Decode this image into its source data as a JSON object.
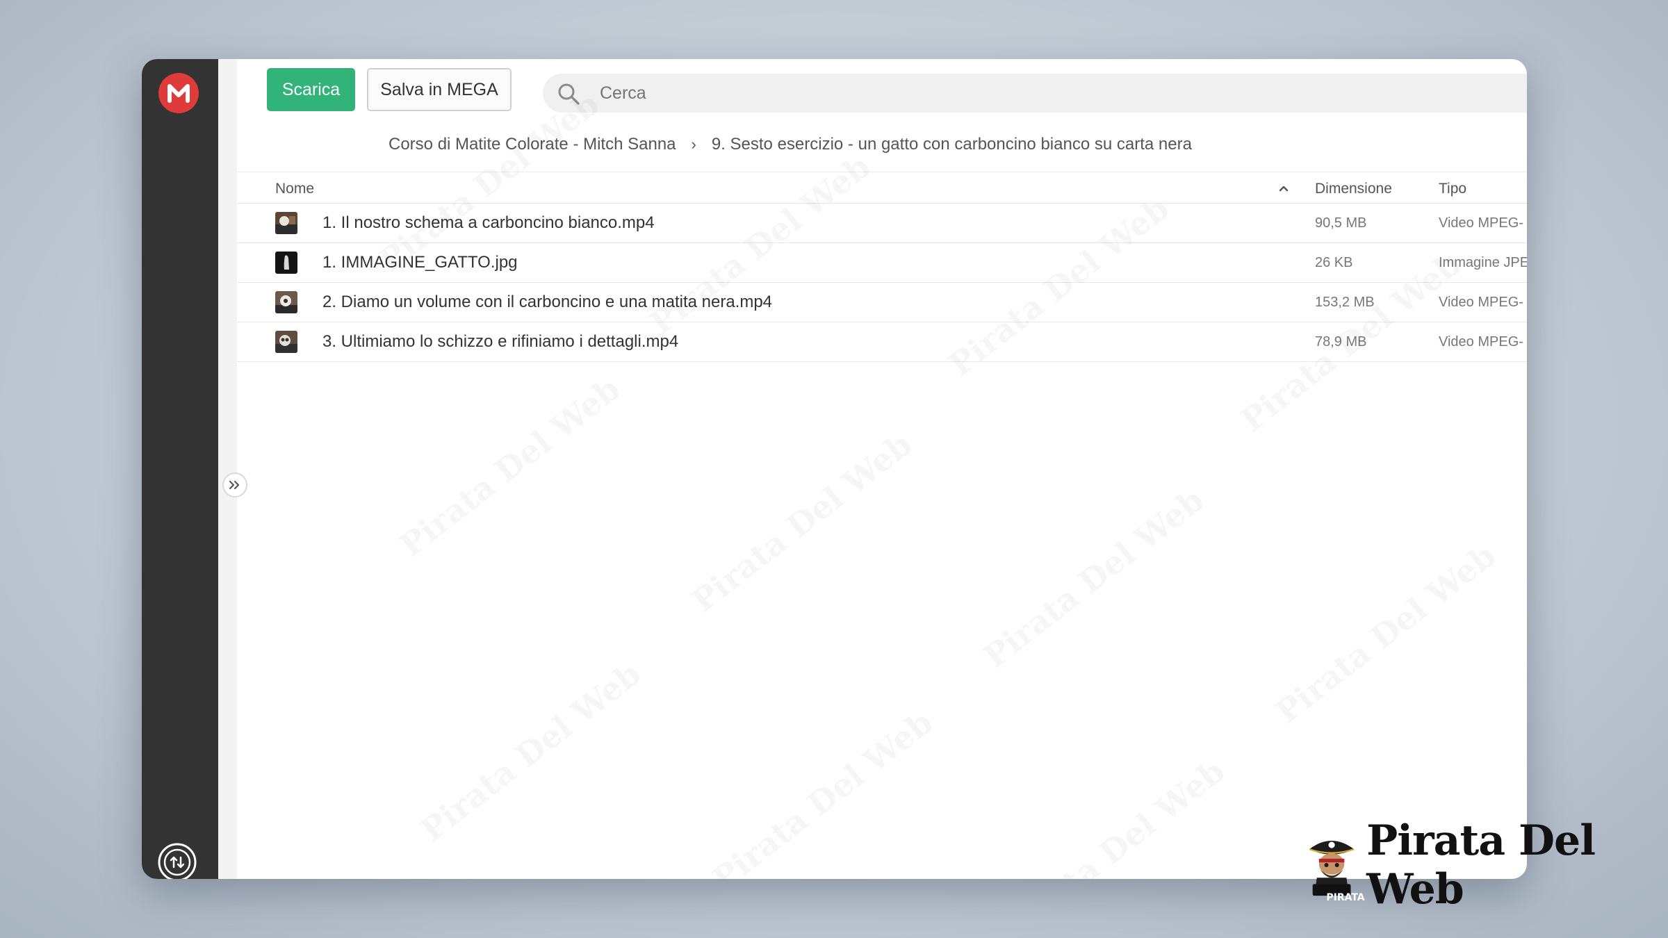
{
  "toolbar": {
    "download_label": "Scarica",
    "save_label": "Salva in MEGA"
  },
  "search": {
    "placeholder": "Cerca"
  },
  "breadcrumb": {
    "items": [
      "Corso di Matite Colorate - Mitch Sanna",
      "9. Sesto esercizio - un gatto con carboncino bianco su carta nera"
    ]
  },
  "table": {
    "columns": {
      "name": "Nome",
      "size": "Dimensione",
      "type": "Tipo"
    },
    "rows": [
      {
        "name": "1. Il nostro schema a carboncino bianco.mp4",
        "size": "90,5 MB",
        "type": "Video MPEG-"
      },
      {
        "name": "1. IMMAGINE_GATTO.jpg",
        "size": "26 KB",
        "type": "Immagine JPE"
      },
      {
        "name": "2. Diamo un volume con il carboncino e una matita nera.mp4",
        "size": "153,2 MB",
        "type": "Video MPEG-"
      },
      {
        "name": "3. Ultimiamo lo schizzo e rifiniamo i dettagli.mp4",
        "size": "78,9 MB",
        "type": "Video MPEG-"
      }
    ]
  },
  "brand": {
    "name": "Pirata Del Web",
    "badge": "PIRATA"
  },
  "colors": {
    "accent_green": "#31b37a",
    "mega_red": "#e03b3b",
    "sidebar": "#333333"
  }
}
